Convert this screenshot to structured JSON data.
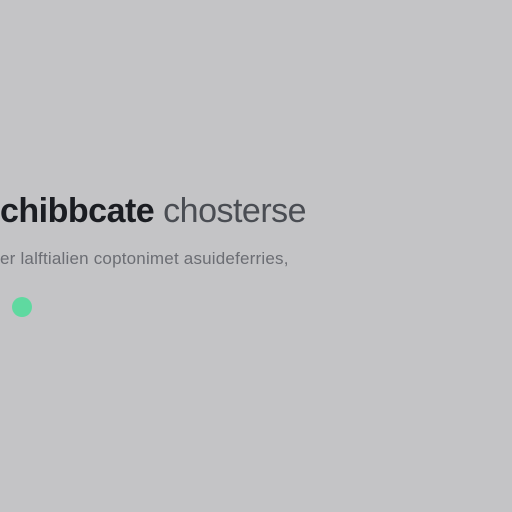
{
  "hero": {
    "headline_bold": "chibbcate",
    "headline_rest": " chosterse",
    "subline": "er lalftialien coptonimet asuideferries,",
    "accent_color": "#5fd9a0"
  }
}
